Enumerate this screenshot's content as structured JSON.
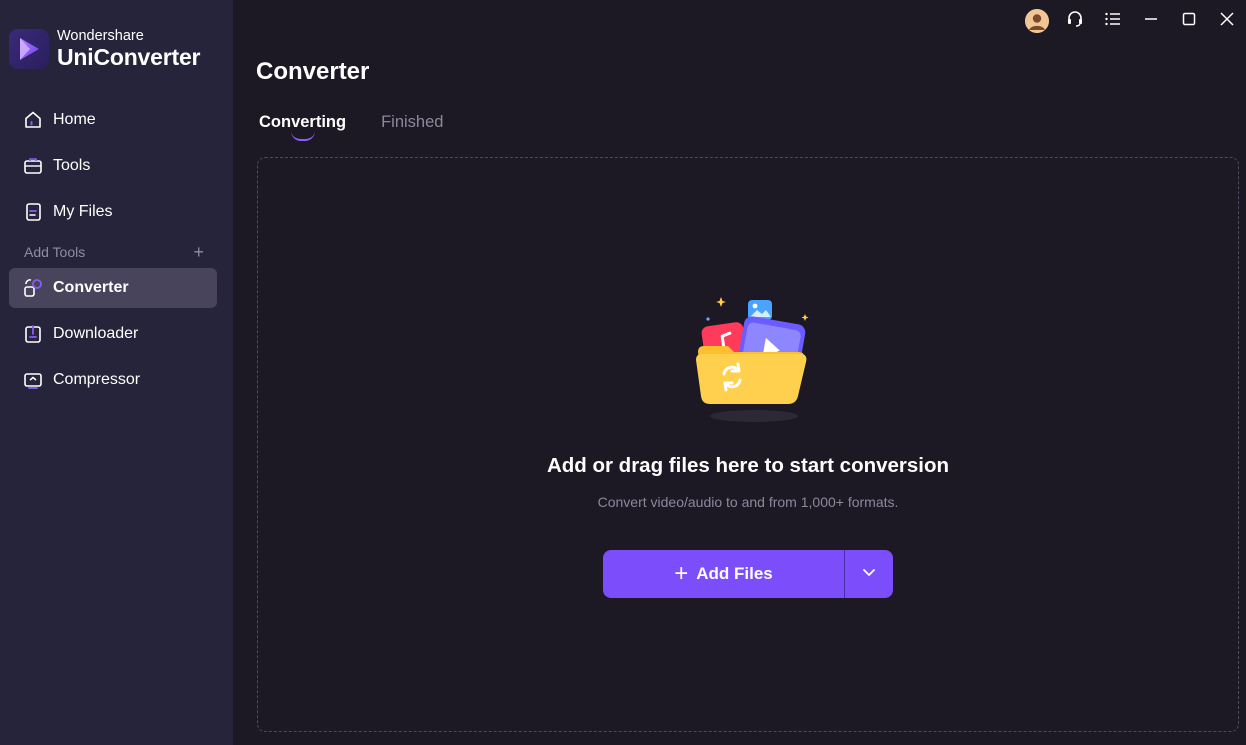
{
  "app": {
    "company": "Wondershare",
    "product": "UniConverter"
  },
  "sidebar": {
    "items": [
      {
        "label": "Home",
        "icon": "home-icon"
      },
      {
        "label": "Tools",
        "icon": "toolbox-icon"
      },
      {
        "label": "My Files",
        "icon": "file-icon"
      }
    ],
    "section_label": "Add Tools",
    "section_add": "+",
    "tools": [
      {
        "label": "Converter",
        "icon": "converter-icon",
        "active": true
      },
      {
        "label": "Downloader",
        "icon": "download-icon",
        "active": false
      },
      {
        "label": "Compressor",
        "icon": "compress-icon",
        "active": false
      }
    ]
  },
  "titlebar": {
    "icons": [
      "avatar-icon",
      "headset-icon",
      "menu-icon",
      "minimize-icon",
      "maximize-icon",
      "close-icon"
    ]
  },
  "main": {
    "title": "Converter",
    "tabs": [
      {
        "label": "Converting",
        "active": true
      },
      {
        "label": "Finished",
        "active": false
      }
    ],
    "dropzone": {
      "title": "Add or drag files here to start conversion",
      "subtitle": "Convert video/audio to and from 1,000+ formats.",
      "button_label": "Add Files",
      "button_plus": "+"
    }
  },
  "colors": {
    "accent": "#7c4dfa",
    "sidebar_bg": "#26243a",
    "main_bg": "#1c1924",
    "active_item_bg": "#47445c"
  }
}
